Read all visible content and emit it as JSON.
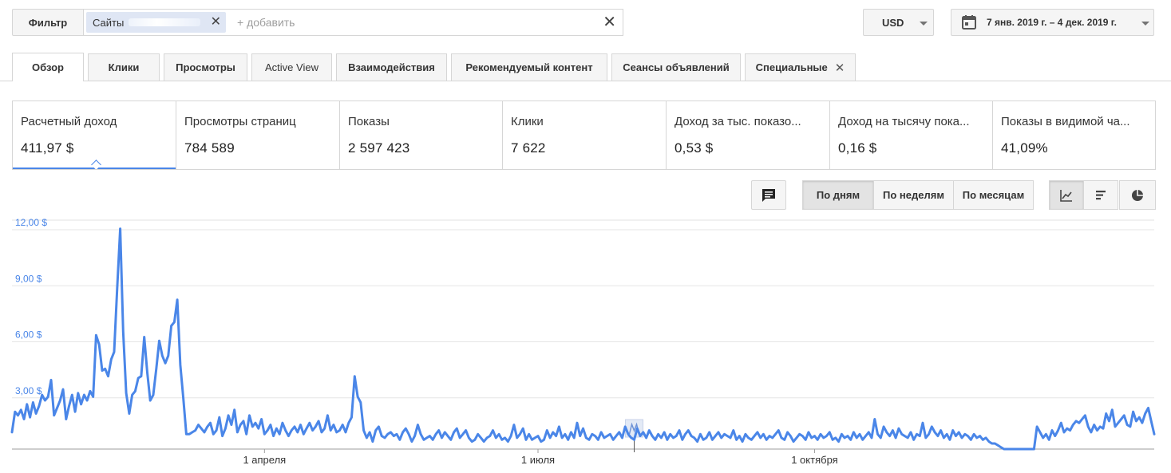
{
  "filter": {
    "label": "Фильтр",
    "chip_label": "Сайты",
    "add_placeholder": "+ добавить"
  },
  "currency": {
    "value": "USD"
  },
  "date_range": {
    "value": "7 янв. 2019 г. – 4 дек. 2019 г."
  },
  "tabs": [
    {
      "label": "Обзор",
      "active": true
    },
    {
      "label": "Клики"
    },
    {
      "label": "Просмотры"
    },
    {
      "label": "Active View"
    },
    {
      "label": "Взаимодействия"
    },
    {
      "label": "Рекомендуемый контент"
    },
    {
      "label": "Сеансы объявлений"
    },
    {
      "label": "Специальные",
      "closable": true
    }
  ],
  "metrics": [
    {
      "label": "Расчетный доход",
      "value": "411,97 $",
      "selected": true
    },
    {
      "label": "Просмотры страниц",
      "value": "784 589"
    },
    {
      "label": "Показы",
      "value": "2 597 423"
    },
    {
      "label": "Клики",
      "value": "7 622"
    },
    {
      "label": "Доход за тыс. показо...",
      "value": "0,53 $"
    },
    {
      "label": "Доход на тысячу пока...",
      "value": "0,16 $"
    },
    {
      "label": "Показы в видимой ча...",
      "value": "41,09%"
    }
  ],
  "periods": [
    {
      "label": "По дням",
      "active": true
    },
    {
      "label": "По неделям"
    },
    {
      "label": "По месяцам"
    }
  ],
  "chart_types": [
    "line-chart-icon",
    "bar-chart-icon",
    "pie-chart-icon"
  ],
  "colors": {
    "accent": "#4a86e8",
    "line": "#4a86e8"
  },
  "chart_data": {
    "type": "line",
    "series": [
      {
        "values": [
          0.9,
          2.0,
          1.8,
          2.1,
          1.6,
          2.4,
          1.7,
          2.5,
          1.9,
          2.3,
          2.9,
          2.6,
          2.8,
          3.7,
          1.8,
          2.2,
          2.6,
          3.2,
          1.6,
          2.3,
          2.9,
          2.0,
          3.0,
          2.4,
          2.9,
          2.6,
          3.1,
          2.8,
          6.1,
          5.6,
          4.2,
          4.3,
          3.9,
          4.8,
          5.2,
          8.6,
          11.8,
          6.3,
          3.0,
          1.9,
          2.9,
          3.1,
          3.8,
          3.9,
          6.0,
          4.1,
          2.6,
          2.9,
          4.3,
          5.8,
          5.0,
          4.6,
          5.0,
          6.6,
          6.8,
          8.0,
          4.5,
          2.7,
          0.8,
          0.8,
          0.9,
          1.0,
          1.3,
          1.1,
          0.9,
          1.2,
          1.4,
          0.8,
          1.0,
          1.7,
          0.7,
          1.1,
          1.8,
          1.3,
          2.1,
          0.9,
          1.3,
          1.5,
          0.8,
          1.8,
          1.2,
          1.4,
          1.1,
          1.6,
          0.8,
          1.0,
          1.3,
          0.7,
          1.1,
          0.8,
          1.4,
          1.0,
          0.7,
          1.0,
          1.2,
          0.9,
          1.3,
          0.8,
          1.1,
          1.4,
          1.0,
          1.2,
          1.5,
          0.9,
          1.1,
          1.8,
          1.0,
          1.3,
          0.9,
          1.0,
          1.3,
          0.9,
          1.4,
          1.7,
          3.9,
          2.8,
          2.5,
          1.0,
          0.6,
          0.9,
          0.4,
          1.0,
          1.2,
          0.7,
          0.6,
          0.8,
          0.9,
          0.7,
          0.8,
          0.5,
          0.9,
          1.1,
          0.8,
          0.4,
          0.7,
          1.3,
          0.8,
          0.5,
          0.6,
          0.7,
          0.5,
          0.8,
          1.0,
          0.6,
          0.9,
          0.7,
          0.5,
          0.9,
          1.1,
          0.6,
          0.8,
          1.0,
          0.6,
          0.4,
          0.5,
          0.8,
          0.6,
          0.4,
          0.6,
          0.7,
          1.0,
          0.6,
          0.8,
          0.5,
          0.6,
          0.4,
          0.7,
          1.3,
          0.6,
          0.8,
          1.1,
          0.5,
          0.8,
          0.5,
          0.6,
          0.7,
          0.4,
          0.5,
          1.0,
          0.6,
          0.9,
          0.7,
          1.2,
          0.6,
          0.8,
          0.5,
          0.9,
          0.6,
          1.4,
          0.7,
          1.1,
          0.6,
          0.5,
          0.8,
          0.7,
          0.5,
          0.9,
          0.6,
          0.7,
          0.8,
          0.5,
          0.7,
          0.9,
          0.6,
          1.2,
          0.8,
          0.6,
          0.5,
          1.1,
          0.7,
          0.9,
          0.6,
          1.0,
          0.7,
          0.5,
          0.8,
          0.6,
          0.9,
          0.5,
          0.8,
          0.6,
          0.7,
          1.0,
          0.5,
          0.8,
          1.0,
          0.7,
          0.6,
          0.4,
          0.8,
          0.5,
          0.6,
          0.9,
          0.5,
          0.7,
          0.9,
          0.6,
          0.8,
          0.7,
          0.6,
          1.0,
          0.5,
          0.7,
          0.4,
          0.8,
          0.6,
          0.5,
          0.7,
          0.9,
          0.6,
          0.8,
          0.5,
          0.7,
          0.6,
          0.8,
          1.0,
          0.6,
          0.5,
          0.9,
          0.7,
          0.4,
          0.6,
          0.8,
          0.7,
          0.5,
          0.9,
          0.6,
          0.7,
          0.5,
          0.8,
          0.6,
          0.7,
          0.9,
          0.5,
          0.6,
          0.4,
          0.8,
          0.6,
          0.7,
          0.5,
          0.9,
          0.6,
          0.8,
          0.5,
          0.7,
          0.9,
          0.6,
          1.6,
          0.8,
          0.6,
          1.2,
          0.9,
          0.7,
          1.0,
          0.6,
          1.1,
          0.8,
          0.7,
          0.6,
          0.9,
          0.5,
          0.8,
          0.7,
          1.4,
          0.6,
          0.8,
          1.2,
          0.9,
          0.7,
          1.0,
          0.6,
          0.8,
          0.5,
          1.0,
          0.7,
          0.9,
          0.6,
          0.8,
          0.7,
          0.5,
          0.8,
          0.6,
          0.7,
          0.5,
          0.6,
          0.4,
          0.3,
          0.3,
          0.2,
          0.1,
          0.0,
          0.0,
          0.0,
          0.0,
          0.0,
          0.0,
          0.0,
          0.0,
          0.0,
          0.0,
          0.0,
          1.2,
          0.9,
          0.6,
          0.8,
          0.5,
          1.0,
          0.7,
          1.0,
          1.4,
          0.9,
          1.1,
          1.0,
          1.3,
          1.5,
          1.4,
          1.6,
          1.8,
          1.2,
          0.9,
          1.3,
          1.0,
          1.2,
          1.1,
          1.9,
          1.5,
          2.1,
          1.2,
          1.4,
          1.6,
          1.8,
          1.3,
          1.2,
          2.0,
          1.5,
          1.7,
          1.4,
          1.9,
          2.2,
          1.5,
          0.8
        ]
      }
    ],
    "y_ticks": [
      "12,00 $",
      "9,00 $",
      "6,00 $",
      "3,00 $"
    ],
    "x_ticks": [
      {
        "label": "1 апреля",
        "day": 84
      },
      {
        "label": "1 июля",
        "day": 175
      },
      {
        "label": "1 октября",
        "day": 267
      }
    ],
    "ylim": [
      0,
      12
    ],
    "grid": true,
    "annotation_marker": {
      "day": 207,
      "icon": "annotation-flag-icon"
    }
  }
}
